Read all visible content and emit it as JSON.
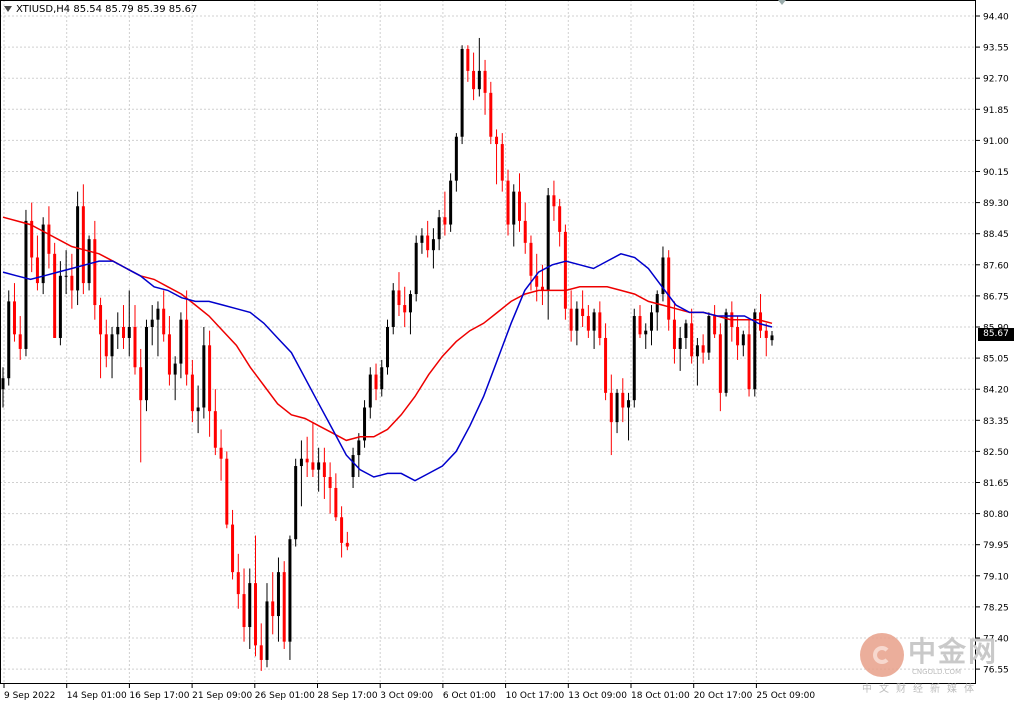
{
  "header": {
    "symbol": "XTIUSD,H4",
    "ohlc": "85.54 85.79 85.39 85.67"
  },
  "last_price_label": "85.67",
  "watermark": {
    "name_cn": "中金网",
    "site": "CNGOLD.COM",
    "tagline": "中文财经新媒体"
  },
  "colors": {
    "bull": "#000000",
    "bear": "#ff0000",
    "ma_fast": "#0000cc",
    "ma_slow": "#ee0000",
    "grid": "#d0d0d0"
  },
  "chart_data": {
    "type": "line",
    "title": "XTIUSD,H4",
    "ylim": [
      78.55,
      94.4
    ],
    "y_ticks": [
      "94.40",
      "93.55",
      "92.70",
      "91.85",
      "91.00",
      "90.15",
      "89.30",
      "88.45",
      "87.60",
      "86.75",
      "85.90",
      "85.05",
      "84.20",
      "83.35",
      "82.50",
      "81.65",
      "80.80",
      "79.95",
      "79.10",
      "78.25",
      "77.40",
      "76.55"
    ],
    "x_ticks": [
      "9 Sep 2022",
      "14 Sep 01:00",
      "16 Sep 17:00",
      "21 Sep 09:00",
      "26 Sep 01:00",
      "28 Sep 17:00",
      "3 Oct 09:00",
      "6 Oct 01:00",
      "10 Oct 17:00",
      "13 Oct 09:00",
      "18 Oct 01:00",
      "20 Oct 17:00",
      "25 Oct 09:00"
    ],
    "grid": true,
    "series": [
      {
        "type": "candlestick",
        "values": [
          [
            84.2,
            84.8,
            83.7,
            84.5
          ],
          [
            84.5,
            86.9,
            84.3,
            86.6
          ],
          [
            86.6,
            87.1,
            85.5,
            85.7
          ],
          [
            85.7,
            86.2,
            85.0,
            85.3
          ],
          [
            85.3,
            89.1,
            85.1,
            88.8
          ],
          [
            88.8,
            89.3,
            87.4,
            87.8
          ],
          [
            87.8,
            88.4,
            86.9,
            87.1
          ],
          [
            87.1,
            88.9,
            86.8,
            88.7
          ],
          [
            88.7,
            89.2,
            87.5,
            87.9
          ],
          [
            87.9,
            88.2,
            85.6,
            85.6
          ],
          [
            85.6,
            87.7,
            85.4,
            87.3
          ],
          [
            87.3,
            88.0,
            86.8,
            87.3
          ],
          [
            87.3,
            87.9,
            86.4,
            86.9
          ],
          [
            86.9,
            89.6,
            86.5,
            89.2
          ],
          [
            89.2,
            89.8,
            86.8,
            87.1
          ],
          [
            87.1,
            88.4,
            86.9,
            88.3
          ],
          [
            88.3,
            88.8,
            86.1,
            86.5
          ],
          [
            86.5,
            86.7,
            84.5,
            85.7
          ],
          [
            85.7,
            86.1,
            84.8,
            85.1
          ],
          [
            85.1,
            85.9,
            84.5,
            85.7
          ],
          [
            85.7,
            86.3,
            85.3,
            85.9
          ],
          [
            85.9,
            86.5,
            85.3,
            85.6
          ],
          [
            85.6,
            86.9,
            85.1,
            85.9
          ],
          [
            85.9,
            86.5,
            84.6,
            84.8
          ],
          [
            84.8,
            85.3,
            82.2,
            83.9
          ],
          [
            83.9,
            86.1,
            83.6,
            85.9
          ],
          [
            85.9,
            86.5,
            85.4,
            86.1
          ],
          [
            86.1,
            86.6,
            85.1,
            86.4
          ],
          [
            86.4,
            86.9,
            85.5,
            85.7
          ],
          [
            85.7,
            86.2,
            84.3,
            84.6
          ],
          [
            84.6,
            85.1,
            83.9,
            84.9
          ],
          [
            84.9,
            86.3,
            84.5,
            86.1
          ],
          [
            86.1,
            86.9,
            84.3,
            84.6
          ],
          [
            84.6,
            85.0,
            83.3,
            83.6
          ],
          [
            83.6,
            84.3,
            83.0,
            83.7
          ],
          [
            83.7,
            85.9,
            83.4,
            85.4
          ],
          [
            85.4,
            85.8,
            82.9,
            83.6
          ],
          [
            83.6,
            84.2,
            82.4,
            82.6
          ],
          [
            82.6,
            83.1,
            81.7,
            82.3
          ],
          [
            82.3,
            82.5,
            80.4,
            80.5
          ],
          [
            80.5,
            80.9,
            79.0,
            79.2
          ],
          [
            79.2,
            79.7,
            78.2,
            78.6
          ],
          [
            78.6,
            79.3,
            77.3,
            77.7
          ],
          [
            77.7,
            79.3,
            77.1,
            78.9
          ],
          [
            78.9,
            80.2,
            76.9,
            77.2
          ],
          [
            77.2,
            77.8,
            76.5,
            76.8
          ],
          [
            76.8,
            78.9,
            76.6,
            78.4
          ],
          [
            78.4,
            79.2,
            77.5,
            78.0
          ],
          [
            78.0,
            79.6,
            77.3,
            79.2
          ],
          [
            79.2,
            79.5,
            77.1,
            77.3
          ],
          [
            77.3,
            80.2,
            76.8,
            80.1
          ],
          [
            80.1,
            82.3,
            79.9,
            82.1
          ],
          [
            82.1,
            82.8,
            81.0,
            82.3
          ],
          [
            82.3,
            82.9,
            81.8,
            82.2
          ],
          [
            82.2,
            83.3,
            81.8,
            82.0
          ],
          [
            82.0,
            82.6,
            81.4,
            82.2
          ],
          [
            82.2,
            82.6,
            81.2,
            81.8
          ],
          [
            81.8,
            82.2,
            80.8,
            81.5
          ],
          [
            81.5,
            81.9,
            80.6,
            80.7
          ],
          [
            80.7,
            81.0,
            79.6,
            80.0
          ],
          [
            80.0,
            80.3,
            79.8,
            79.9
          ],
          [
            81.8,
            82.6,
            81.5,
            82.4
          ],
          [
            82.4,
            83.0,
            81.8,
            82.8
          ],
          [
            82.8,
            83.9,
            82.6,
            83.7
          ],
          [
            83.7,
            84.8,
            83.4,
            84.6
          ],
          [
            84.6,
            84.9,
            83.9,
            84.2
          ],
          [
            84.2,
            85.0,
            84.0,
            84.8
          ],
          [
            84.8,
            86.1,
            84.6,
            85.9
          ],
          [
            85.9,
            87.1,
            85.7,
            86.9
          ],
          [
            86.9,
            87.4,
            86.2,
            86.5
          ],
          [
            86.5,
            87.0,
            85.9,
            86.3
          ],
          [
            86.3,
            86.9,
            85.7,
            86.8
          ],
          [
            86.8,
            88.4,
            86.6,
            88.2
          ],
          [
            88.2,
            88.6,
            87.9,
            88.4
          ],
          [
            88.4,
            88.8,
            87.8,
            88.0
          ],
          [
            88.0,
            88.6,
            87.5,
            88.3
          ],
          [
            88.3,
            89.1,
            88.0,
            88.9
          ],
          [
            88.9,
            89.6,
            88.4,
            88.7
          ],
          [
            88.7,
            90.1,
            88.5,
            89.9
          ],
          [
            89.9,
            91.2,
            89.6,
            91.1
          ],
          [
            91.1,
            93.6,
            90.9,
            93.5
          ],
          [
            93.5,
            93.6,
            92.6,
            92.9
          ],
          [
            92.9,
            93.4,
            92.1,
            92.4
          ],
          [
            92.4,
            93.8,
            92.2,
            92.9
          ],
          [
            92.9,
            93.2,
            91.7,
            92.3
          ],
          [
            92.3,
            92.6,
            90.9,
            91.1
          ],
          [
            91.1,
            91.3,
            89.8,
            90.9
          ],
          [
            90.9,
            91.2,
            89.6,
            89.9
          ],
          [
            89.9,
            90.2,
            88.4,
            88.7
          ],
          [
            88.7,
            89.8,
            88.1,
            89.6
          ],
          [
            89.6,
            90.1,
            88.5,
            88.8
          ],
          [
            88.8,
            89.3,
            87.9,
            88.2
          ],
          [
            88.2,
            88.4,
            86.9,
            87.3
          ],
          [
            87.3,
            87.9,
            86.6,
            87.0
          ],
          [
            87.0,
            87.6,
            86.5,
            86.9
          ],
          [
            86.9,
            89.7,
            86.1,
            89.5
          ],
          [
            89.5,
            89.9,
            88.8,
            89.2
          ],
          [
            89.2,
            89.4,
            88.1,
            88.5
          ],
          [
            88.5,
            88.7,
            86.1,
            86.4
          ],
          [
            86.4,
            86.9,
            85.5,
            85.8
          ],
          [
            85.8,
            86.6,
            85.4,
            86.4
          ],
          [
            86.4,
            86.9,
            85.9,
            86.2
          ],
          [
            86.2,
            86.5,
            85.6,
            85.8
          ],
          [
            85.8,
            86.4,
            85.3,
            86.3
          ],
          [
            86.3,
            86.6,
            85.4,
            85.6
          ],
          [
            85.6,
            86.0,
            83.9,
            84.1
          ],
          [
            84.1,
            84.6,
            82.4,
            83.3
          ],
          [
            83.3,
            84.2,
            83.0,
            84.1
          ],
          [
            84.1,
            84.5,
            83.3,
            83.7
          ],
          [
            83.7,
            84.1,
            82.8,
            83.9
          ],
          [
            83.9,
            86.4,
            83.7,
            86.2
          ],
          [
            86.2,
            86.5,
            85.6,
            85.7
          ],
          [
            85.7,
            86.0,
            85.3,
            85.8
          ],
          [
            85.8,
            86.5,
            85.4,
            86.3
          ],
          [
            86.3,
            86.9,
            85.8,
            86.8
          ],
          [
            86.8,
            88.1,
            86.6,
            87.8
          ],
          [
            87.8,
            88.0,
            85.8,
            86.1
          ],
          [
            86.1,
            86.6,
            84.9,
            85.3
          ],
          [
            85.3,
            85.9,
            84.7,
            85.6
          ],
          [
            85.6,
            86.1,
            85.3,
            86.0
          ],
          [
            86.0,
            86.4,
            84.9,
            85.1
          ],
          [
            85.1,
            85.6,
            84.3,
            85.4
          ],
          [
            85.4,
            85.7,
            84.9,
            85.2
          ],
          [
            85.2,
            86.3,
            85.0,
            86.2
          ],
          [
            86.2,
            86.5,
            85.6,
            85.7
          ],
          [
            85.7,
            86.0,
            83.6,
            84.1
          ],
          [
            84.1,
            86.4,
            84.0,
            86.3
          ],
          [
            86.3,
            86.6,
            85.5,
            85.9
          ],
          [
            85.9,
            86.2,
            85.0,
            85.4
          ],
          [
            85.4,
            85.8,
            85.1,
            85.7
          ],
          [
            85.7,
            86.1,
            84.0,
            84.2
          ],
          [
            84.2,
            86.4,
            84.0,
            86.3
          ],
          [
            86.3,
            86.8,
            85.6,
            85.8
          ],
          [
            85.8,
            86.0,
            85.1,
            85.6
          ],
          [
            85.54,
            85.79,
            85.39,
            85.67
          ]
        ]
      },
      {
        "type": "line",
        "values": [
          87.4,
          87.3,
          87.2,
          87.3,
          87.4,
          87.5,
          87.6,
          87.7,
          87.7,
          87.5,
          87.3,
          87.0,
          86.9,
          86.7,
          86.6,
          86.6,
          86.5,
          86.4,
          86.3,
          86.0,
          85.6,
          85.2,
          84.5,
          83.8,
          83.1,
          82.4,
          82.0,
          81.8,
          81.9,
          81.9,
          81.7,
          81.9,
          82.1,
          82.5,
          83.2,
          84.0,
          85.0,
          86.0,
          86.9,
          87.4,
          87.6,
          87.7,
          87.6,
          87.5,
          87.7,
          87.9,
          87.8,
          87.5,
          87.0,
          86.5,
          86.3,
          86.3,
          86.2,
          86.2,
          86.2,
          86.0,
          85.9
        ]
      },
      {
        "type": "line",
        "values": [
          88.9,
          88.8,
          88.7,
          88.5,
          88.3,
          88.1,
          88.0,
          87.9,
          87.7,
          87.5,
          87.3,
          87.2,
          87.0,
          86.8,
          86.5,
          86.2,
          85.8,
          85.4,
          84.8,
          84.3,
          83.8,
          83.5,
          83.4,
          83.2,
          83.0,
          82.8,
          82.9,
          82.9,
          83.1,
          83.5,
          84.0,
          84.6,
          85.1,
          85.5,
          85.8,
          86.0,
          86.3,
          86.6,
          86.8,
          86.9,
          86.9,
          86.9,
          87.0,
          87.0,
          87.0,
          86.9,
          86.8,
          86.6,
          86.5,
          86.4,
          86.3,
          86.3,
          86.2,
          86.1,
          86.1,
          86.1,
          86.0
        ]
      }
    ]
  }
}
